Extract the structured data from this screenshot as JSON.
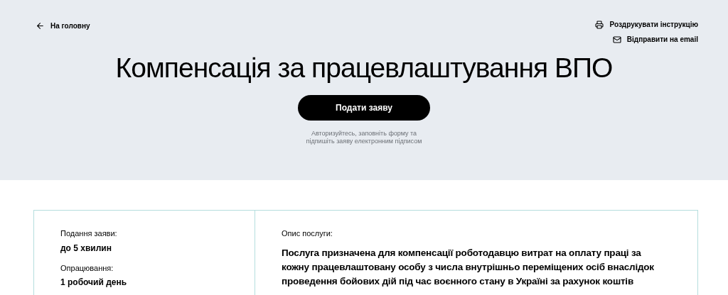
{
  "header": {
    "back_link": "На головну",
    "actions": [
      {
        "kind": "print",
        "label": "Роздрукувати інструкцію"
      },
      {
        "kind": "email",
        "label": "Відправити на email"
      }
    ],
    "title": "Компенсація за працевлаштування ВПО",
    "submit_button": "Подати заяву",
    "hint": "Авторизуйтесь, заповніть форму та підпишіть заяву електронним підписом"
  },
  "info": {
    "facts": [
      {
        "label": "Подання заяви:",
        "value": "до 5 хвилин"
      },
      {
        "label": "Опрацювання:",
        "value": "1 робочий день"
      }
    ],
    "description_label": "Опис послуги:",
    "description": "Послуга призначена для компенсації роботодавцю витрат на оплату праці за кожну працевлаштовану особу з числа внутрішньо переміщених осіб внаслідок проведення бойових дій під час воєнного стану в Україні за рахунок коштів"
  }
}
